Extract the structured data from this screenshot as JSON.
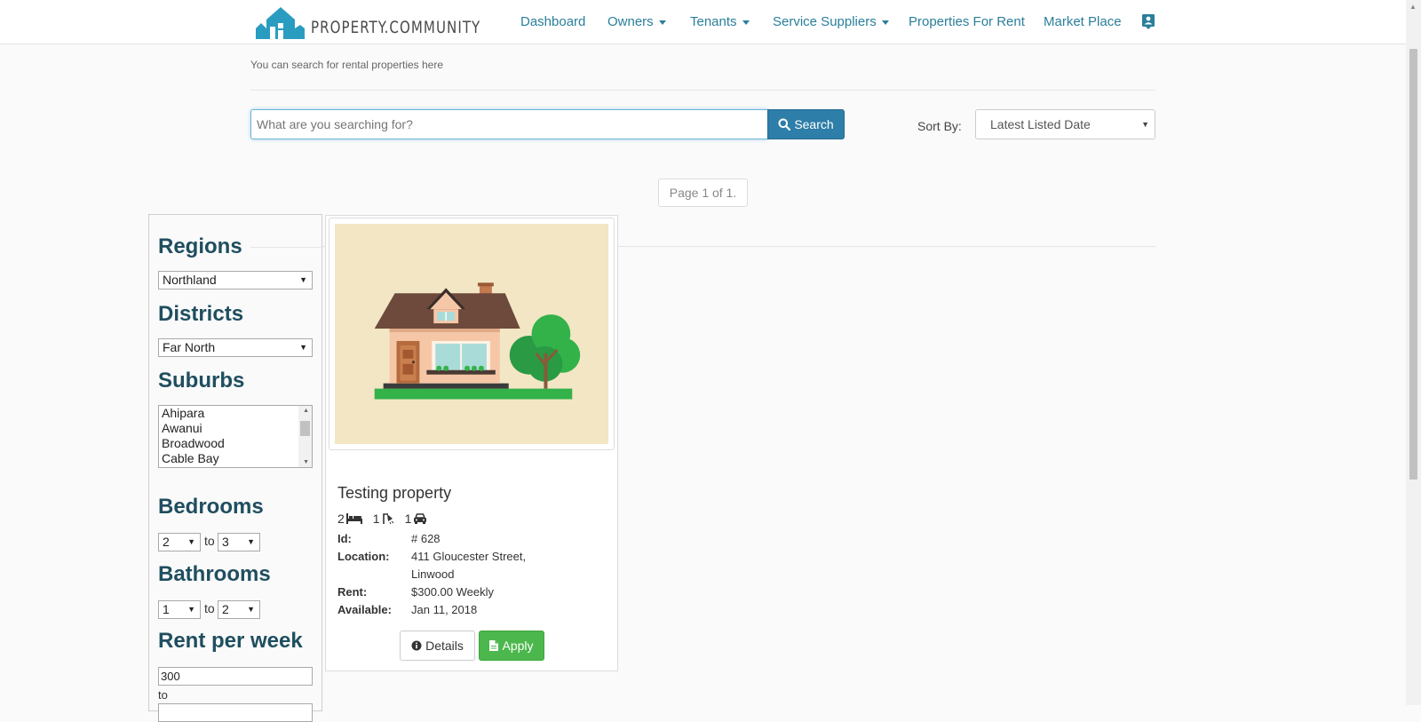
{
  "nav": {
    "brand": "PROPERTY.COMMUNITY",
    "links": [
      {
        "label": "Dashboard",
        "dropdown": false
      },
      {
        "label": "Owners",
        "dropdown": true
      },
      {
        "label": "Tenants",
        "dropdown": true
      },
      {
        "label": "Service Suppliers",
        "dropdown": true
      },
      {
        "label": "Properties For Rent",
        "dropdown": false
      },
      {
        "label": "Market Place",
        "dropdown": false
      }
    ],
    "user_icon": "contact-card-icon"
  },
  "header": {
    "subtitle": "You can search for rental properties here"
  },
  "search": {
    "placeholder": "What are you searching for?",
    "button_label": "Search",
    "sort_label": "Sort By:",
    "sort_value": "Latest Listed Date"
  },
  "pager": {
    "text": "Page 1 of 1."
  },
  "filters": {
    "regions_title": "Regions",
    "region_value": "Northland",
    "districts_title": "Districts",
    "district_value": "Far North",
    "suburbs_title": "Suburbs",
    "suburbs": [
      "Ahipara",
      "Awanui",
      "Broadwood",
      "Cable Bay"
    ],
    "bedrooms_title": "Bedrooms",
    "bedrooms_from": "2",
    "bedrooms_to": "3",
    "bathrooms_title": "Bathrooms",
    "bathrooms_from": "1",
    "bathrooms_to": "2",
    "to_label": "to",
    "rent_title": "Rent per week",
    "rent_from": "300",
    "rent_to_label": "to"
  },
  "property": {
    "title": "Testing property",
    "bedrooms": "2",
    "bathrooms": "1",
    "garages": "1",
    "id_label": "Id:",
    "id_value": "# 628",
    "location_label": "Location:",
    "location_line1": "411 Gloucester Street,",
    "location_line2": "Linwood",
    "rent_label": "Rent:",
    "rent_value": "$300.00 Weekly",
    "available_label": "Available:",
    "available_value": "Jan 11, 2018",
    "details_label": "Details",
    "apply_label": "Apply"
  },
  "colors": {
    "brand": "#2a7f9a",
    "search_button": "#2d7ea8",
    "apply_button": "#4cb74c",
    "heading": "#1f4e5f"
  }
}
